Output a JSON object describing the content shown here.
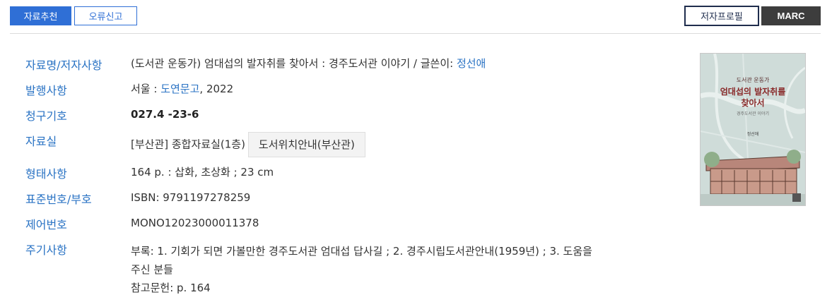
{
  "toolbar": {
    "recommend_label": "자료추천",
    "report_label": "오류신고",
    "author_profile_label": "저자프로필",
    "marc_label": "MARC"
  },
  "fields": {
    "title_author": {
      "label": "자료명/저자사항",
      "text": "(도서관 운동가) 엄대섭의 발자취를 찾아서 : 경주도서관 이야기 / 글쓴이: ",
      "link": "정선애"
    },
    "publication": {
      "label": "발행사항",
      "prefix": "서울 : ",
      "link": "도연문고",
      "suffix": ", 2022"
    },
    "call_number": {
      "label": "청구기호",
      "value": "027.4 -23-6"
    },
    "location": {
      "label": "자료실",
      "value": "[부산관] 종합자료실(1층)",
      "button": "도서위치안내(부산관)"
    },
    "physical": {
      "label": "형태사항",
      "value": "164 p. : 삽화, 초상화 ; 23 cm"
    },
    "standard_no": {
      "label": "표준번호/부호",
      "value": "ISBN: 9791197278259"
    },
    "control_no": {
      "label": "제어번호",
      "value": "MONO12023000011378"
    },
    "notes": {
      "label": "주기사항",
      "line1": "부록: 1. 기회가 되면 가볼만한 경주도서관 엄대섭 답사길 ; 2. 경주시립도서관안내(1959년) ; 3. 도움을",
      "line2": "주신 분들",
      "line3": "참고문헌: p. 164"
    }
  },
  "cover": {
    "series": "도서관 운동가",
    "title_line1": "엄대섭의 발자취를",
    "title_line2": "찾아서",
    "subtitle": "경주도서관 이야기",
    "author": "정선애",
    "bg_color": "#cfdcd9",
    "title_color": "#8a2a2a"
  }
}
